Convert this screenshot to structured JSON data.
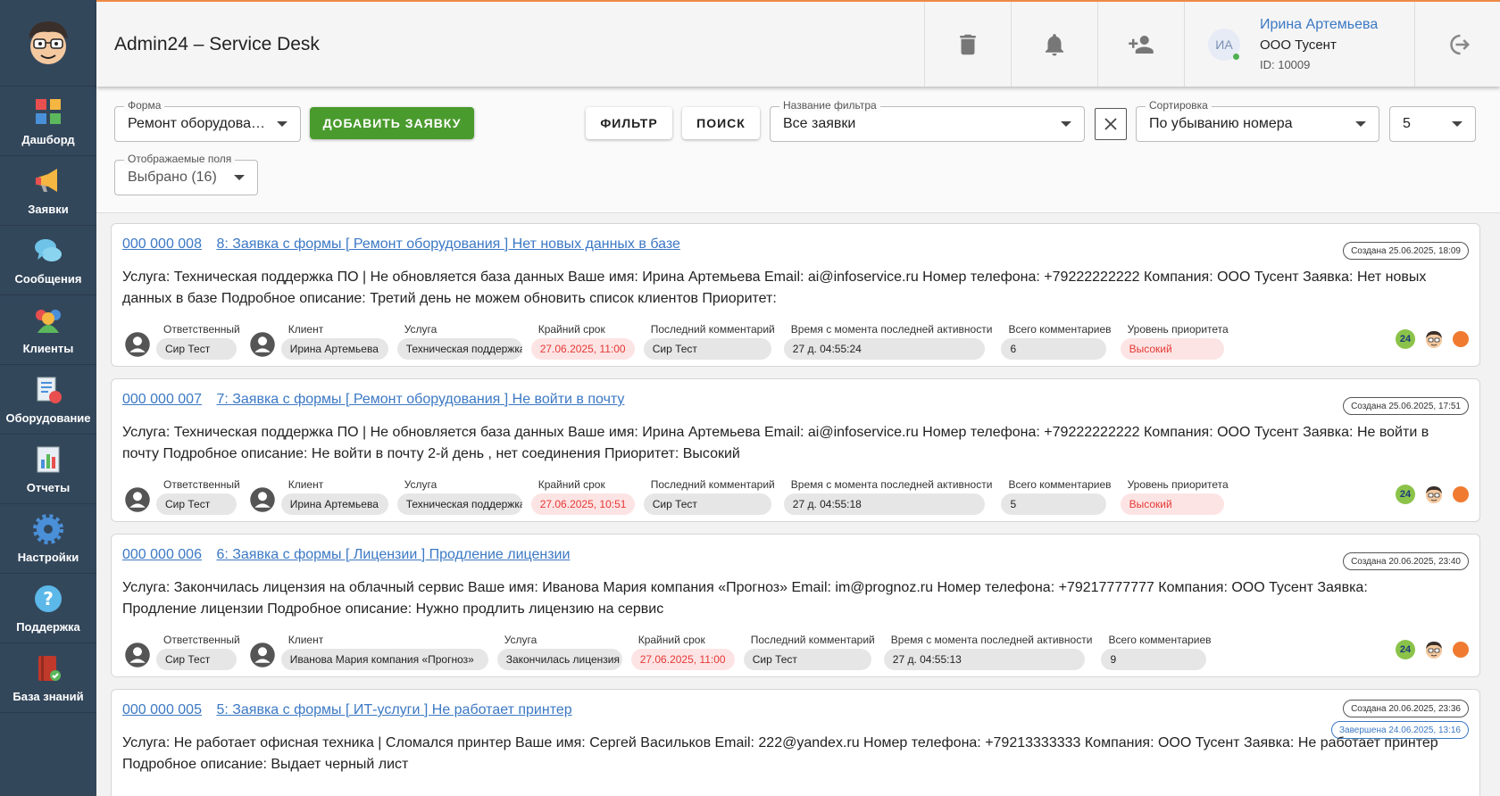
{
  "app": {
    "title": "Admin24 – Service Desk"
  },
  "sidebar": {
    "items": [
      {
        "label": "Дашборд",
        "icon": "dashboard-icon"
      },
      {
        "label": "Заявки",
        "icon": "megaphone-icon"
      },
      {
        "label": "Сообщения",
        "icon": "chat-icon"
      },
      {
        "label": "Клиенты",
        "icon": "clients-icon"
      },
      {
        "label": "Оборудование",
        "icon": "equipment-icon"
      },
      {
        "label": "Отчеты",
        "icon": "report-icon"
      },
      {
        "label": "Настройки",
        "icon": "gear-icon"
      },
      {
        "label": "Поддержка",
        "icon": "help-icon"
      },
      {
        "label": "База знаний",
        "icon": "book-icon"
      }
    ]
  },
  "user": {
    "initials": "ИА",
    "name": "Ирина Артемьева",
    "company": "ООО Тусент",
    "id": "ID: 10009"
  },
  "filters": {
    "form_label": "Форма",
    "form_value": "Ремонт оборудования",
    "add_button": "ДОБАВИТЬ ЗАЯВКУ",
    "filter_button": "ФИЛЬТР",
    "search_button": "ПОИСК",
    "filter_name_label": "Название фильтра",
    "filter_name_value": "Все заявки",
    "sort_label": "Сортировка",
    "sort_value": "По убыванию номера",
    "page_size": "5",
    "fields_label": "Отображаемые поля",
    "fields_value": "Выбрано (16)"
  },
  "labels": {
    "responsible": "Ответственный",
    "client": "Клиент",
    "service": "Услуга",
    "deadline": "Крайний срок",
    "last_comment": "Последний комментарий",
    "since_activity": "Время с момента последней активности",
    "total_comments": "Всего комментариев",
    "priority": "Уровень приоритета",
    "badge24": "24"
  },
  "tickets": [
    {
      "number": "000 000 008",
      "title": "8: Заявка с формы [ Ремонт оборудования ] Нет новых данных в базе",
      "created": "Создана 25.06.2025, 18:09",
      "description": "Услуга: Техническая поддержка ПО | Не обновляется база данных Ваше имя: Ирина Артемьева Email: ai@infoservice.ru Номер телефона: +79222222222 Компания: ООО Тусент Заявка: Нет новых данных в базе Подробное описание: Третий день не можем обновить список клиентов Приоритет:",
      "responsible": "Сир Тест",
      "client": "Ирина Артемьева",
      "service": "Техническая поддержка ПО",
      "deadline": "27.06.2025, 11:00",
      "last_comment": "Сир Тест",
      "since_activity": "27 д. 04:55:24",
      "total_comments": "6",
      "priority": "Высокий"
    },
    {
      "number": "000 000 007",
      "title": "7: Заявка с формы [ Ремонт оборудования ] Не войти в почту",
      "created": "Создана 25.06.2025, 17:51",
      "description": "Услуга: Техническая поддержка ПО | Не обновляется база данных Ваше имя: Ирина Артемьева Email: ai@infoservice.ru Номер телефона: +79222222222 Компания: ООО Тусент Заявка: Не войти в почту Подробное описание: Не войти в почту 2-й день , нет соединения Приоритет: Высокий",
      "responsible": "Сир Тест",
      "client": "Ирина Артемьева",
      "service": "Техническая поддержка ПО",
      "deadline": "27.06.2025, 10:51",
      "last_comment": "Сир Тест",
      "since_activity": "27 д. 04:55:18",
      "total_comments": "5",
      "priority": "Высокий"
    },
    {
      "number": "000 000 006",
      "title": "6: Заявка с формы [ Лицензии ] Продление лицензии",
      "created": "Создана 20.06.2025, 23:40",
      "description": "Услуга: Закончилась лицензия на облачный сервис Ваше имя: Иванова Мария компания «Прогноз» Email: im@prognoz.ru Номер телефона: +79217777777 Компания: ООО Тусент Заявка: Продление лицензии Подробное описание: Нужно продлить лицензию на сервис",
      "responsible": "Сир Тест",
      "client": "Иванова Мария компания «Прогноз»",
      "service": "Закончилась лицензия на облачный сервис",
      "deadline": "27.06.2025, 11:00",
      "last_comment": "Сир Тест",
      "since_activity": "27 д. 04:55:13",
      "total_comments": "9"
    },
    {
      "number": "000 000 005",
      "title": "5: Заявка с формы [ ИТ-услуги ] Не работает принтер",
      "created": "Создана 20.06.2025, 23:36",
      "completed": "Завершена 24.06.2025, 13:16",
      "description": "Услуга: Не работает офисная техника | Сломался принтер Ваше имя: Сергей Васильков Email: 222@yandex.ru Номер телефона: +79213333333 Компания: ООО Тусент Заявка: Не работает принтер Подробное описание: Выдает черный лист"
    }
  ],
  "colors": {
    "sidebar": "#33475b",
    "accent": "#3b78c4",
    "green": "#4a9b2e",
    "orange": "#f07b30",
    "red": "#e53935"
  }
}
